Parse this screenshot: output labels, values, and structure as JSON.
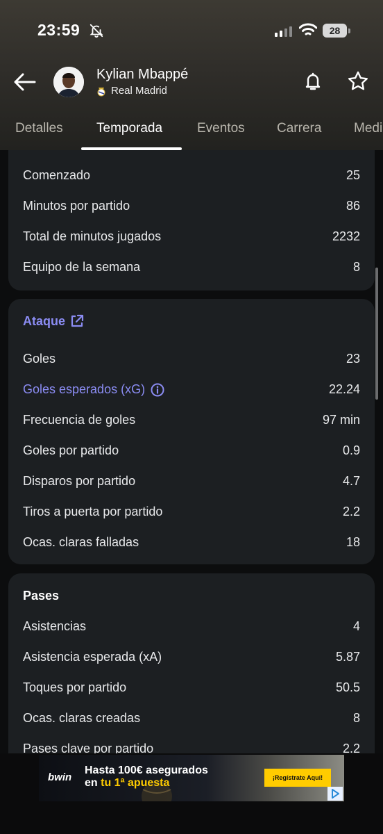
{
  "status_bar": {
    "time": "23:59",
    "battery": "28"
  },
  "player": {
    "name": "Kylian Mbappé",
    "club": "Real Madrid"
  },
  "tabs": [
    "Detalles",
    "Temporada",
    "Eventos",
    "Carrera",
    "Medi"
  ],
  "active_tab": "Temporada",
  "appearances": {
    "rows": [
      {
        "label": "Comenzado",
        "value": "25"
      },
      {
        "label": "Minutos por partido",
        "value": "86"
      },
      {
        "label": "Total de minutos jugados",
        "value": "2232"
      },
      {
        "label": "Equipo de la semana",
        "value": "8"
      }
    ]
  },
  "attack": {
    "title": "Ataque",
    "rows": [
      {
        "label": "Goles",
        "value": "23"
      },
      {
        "label": "Goles esperados (xG)",
        "value": "22.24"
      },
      {
        "label": "Frecuencia de goles",
        "value": "97 min"
      },
      {
        "label": "Goles por partido",
        "value": "0.9"
      },
      {
        "label": "Disparos por partido",
        "value": "4.7"
      },
      {
        "label": "Tiros a puerta por partido",
        "value": "2.2"
      },
      {
        "label": "Ocas. claras falladas",
        "value": "18"
      }
    ]
  },
  "passes": {
    "title": "Pases",
    "rows": [
      {
        "label": "Asistencias",
        "value": "4"
      },
      {
        "label": "Asistencia esperada (xA)",
        "value": "5.87"
      },
      {
        "label": "Toques por partido",
        "value": "50.5"
      },
      {
        "label": "Ocas. claras creadas",
        "value": "8"
      },
      {
        "label": "Pases clave por partido",
        "value": "2.2"
      }
    ]
  },
  "ad": {
    "brand": "bwin",
    "line1": "Hasta 100€ asegurados",
    "line2_prefix": "en",
    "line2_highlight": "tu 1ª apuesta",
    "cta": "¡Regístrate Aquí!"
  },
  "colors": {
    "accent": "#8b8cf3",
    "card": "#1c1f22",
    "background": "#0c0d0e"
  }
}
